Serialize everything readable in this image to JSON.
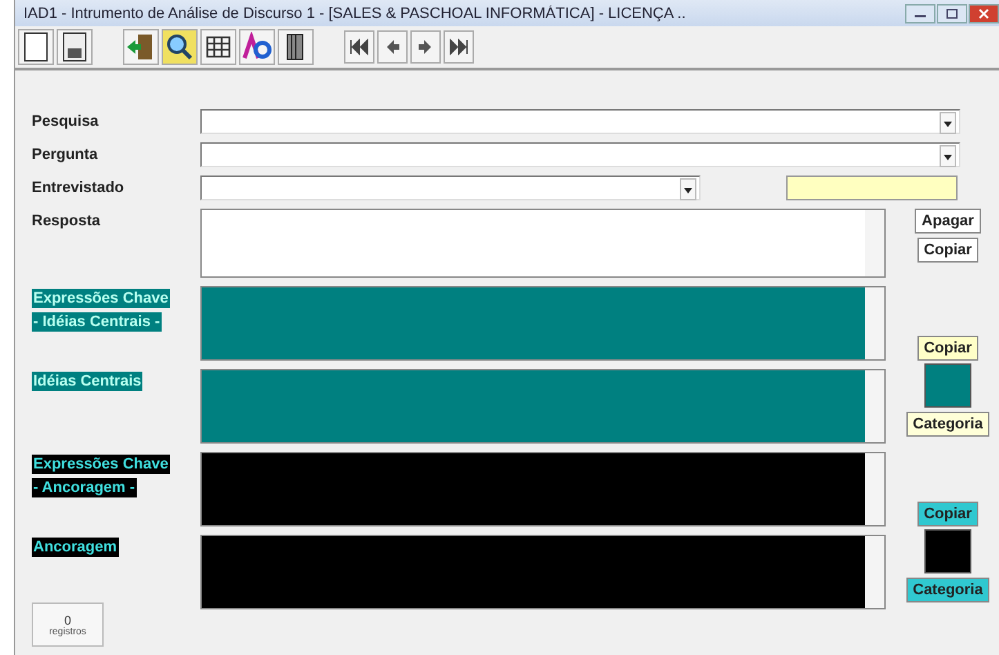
{
  "window": {
    "title": "IAD1 - Intrumento de Análise de Discurso 1  -  [SALES & PASCHOAL INFORMÁTICA]  - LICENÇA .."
  },
  "fields": [
    {
      "label": "Pesquisa",
      "kind": "combo"
    },
    {
      "label": "Pergunta",
      "kind": "combo"
    },
    {
      "label": "Entrevistado",
      "kind": "combo-short"
    },
    {
      "label": "Resposta",
      "kind": "memo"
    }
  ],
  "response_buttons": [
    {
      "label": "Apagar",
      "color": "#ffffff"
    },
    {
      "label": "Copiar",
      "color": "#ffffff"
    }
  ],
  "sections": [
    {
      "label_lines": [
        "Expressões Chave",
        "- Idéias Centrais -"
      ],
      "color": "#008080",
      "swatch": false,
      "button": {
        "label": "Copiar",
        "color": "#ffffc8"
      }
    },
    {
      "label_lines": [
        "Idéias Centrais"
      ],
      "color": "#008080",
      "swatch": true,
      "button": {
        "label": "Categoria",
        "color": "#ffffd8"
      }
    },
    {
      "label_lines": [
        "Expressões Chave",
        "- Ancoragem -"
      ],
      "color": "#000000",
      "swatch": false,
      "button": {
        "label": "Copiar",
        "color": "#30c8d0"
      }
    },
    {
      "label_lines": [
        "Ancoragem"
      ],
      "color": "#000000",
      "swatch": true,
      "button": {
        "label": "Categoria",
        "color": "#30c8d0"
      }
    }
  ],
  "record_counter": {
    "count": "0",
    "label": "registros"
  }
}
